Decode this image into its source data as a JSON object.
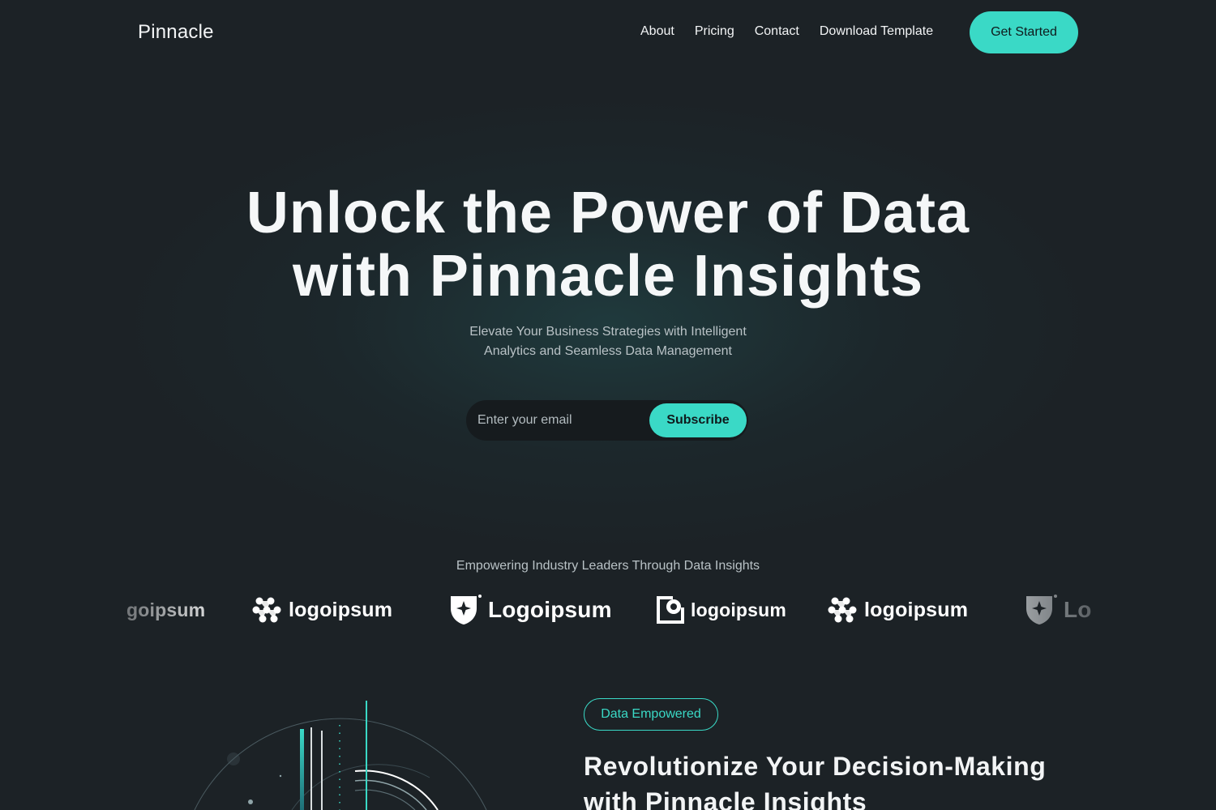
{
  "nav": {
    "brand": "Pinnacle",
    "links": [
      "About",
      "Pricing",
      "Contact",
      "Download Template"
    ],
    "cta": "Get Started"
  },
  "hero": {
    "title_line1": "Unlock the Power of Data",
    "title_line2": "with Pinnacle Insights",
    "subtitle_line1": "Elevate Your Business Strategies with Intelligent",
    "subtitle_line2": "Analytics and Seamless Data Management",
    "email_placeholder": "Enter your email",
    "subscribe_label": "Subscribe"
  },
  "logos": {
    "heading": "Empowering Industry Leaders Through Data Insights",
    "items": [
      {
        "text": "logoipsum",
        "icon": "partial-logo",
        "partial": "goipsum"
      },
      {
        "text": "logoipsum",
        "icon": "wave-dots-icon"
      },
      {
        "text": "Logoipsum",
        "icon": "shield-star-icon"
      },
      {
        "text": "logoipsum",
        "icon": "square-circle-icon"
      },
      {
        "text": "logoipsum",
        "icon": "wave-dots-icon"
      },
      {
        "text": "Lo",
        "icon": "shield-star-icon"
      }
    ]
  },
  "section2": {
    "badge": "Data Empowered",
    "title_line1": "Revolutionize Your Decision-Making",
    "title_line2": "with Pinnacle Insights"
  },
  "colors": {
    "background": "#1c2226",
    "accent": "#3ad9c6",
    "text": "#f2f4f5",
    "muted": "#b9c2c6"
  }
}
